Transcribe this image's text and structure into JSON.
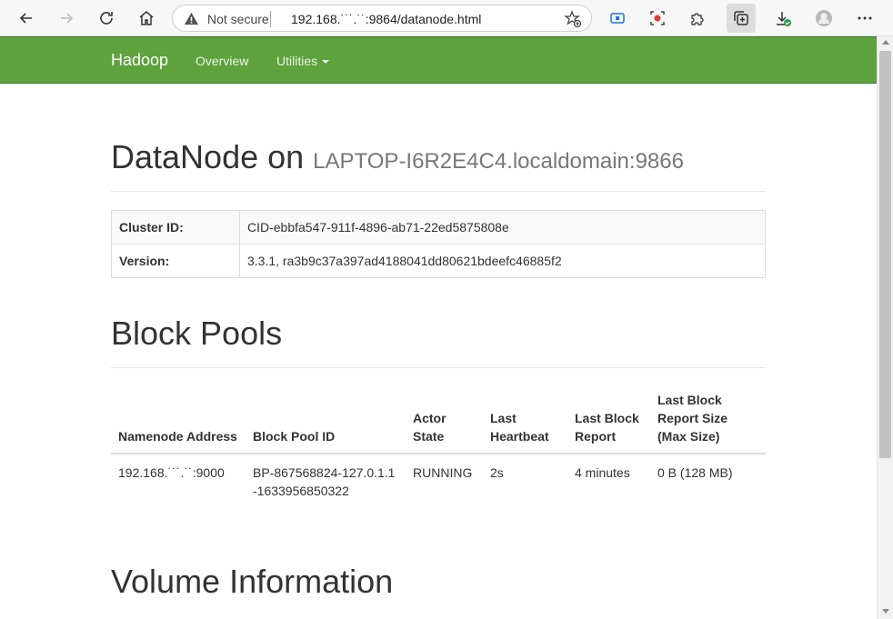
{
  "browser": {
    "not_secure": "Not secure",
    "url": "192.168.˙˙˙.˙˙:9864/datanode.html"
  },
  "nav": {
    "brand": "Hadoop",
    "overview": "Overview",
    "utilities": "Utilities"
  },
  "header": {
    "title": "DataNode on",
    "host": "LAPTOP-I6R2E4C4.localdomain:9866"
  },
  "info": {
    "cluster_label": "Cluster ID:",
    "cluster_value": "CID-ebbfa547-911f-4896-ab71-22ed5875808e",
    "version_label": "Version:",
    "version_value": "3.3.1, ra3b9c37a397ad4188041dd80621bdeefc46885f2"
  },
  "block_pools": {
    "title": "Block Pools",
    "headers": [
      "Namenode Address",
      "Block Pool ID",
      "Actor State",
      "Last Heartbeat",
      "Last Block Report",
      "Last Block Report Size (Max Size)"
    ],
    "row": [
      "192.168.˙˙˙.˙˙:9000",
      "BP-867568824-127.0.1.1-1633956850322",
      "RUNNING",
      "2s",
      "4 minutes",
      "0 B (128 MB)"
    ]
  },
  "volume": {
    "title": "Volume Information"
  }
}
